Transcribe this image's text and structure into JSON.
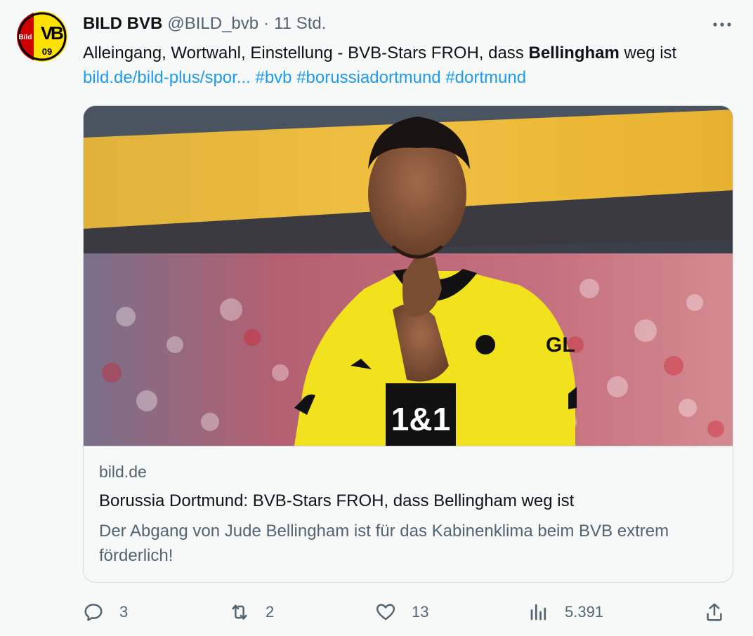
{
  "tweet": {
    "author_name": "BILD BVB",
    "handle": "@BILD_bvb",
    "separator": "·",
    "time": "11 Std.",
    "avatar_icon": "bild-bvb-logo",
    "more_icon": "more-icon",
    "text": {
      "part1": "Alleingang, Wortwahl, Einstellung - BVB-Stars FROH, dass ",
      "bold": "Bellingham",
      "part2": " weg ist ",
      "link": "bild.de/bild-plus/spor...",
      "hashtags": [
        "#bvb",
        "#borussiadortmund",
        "#dortmund"
      ]
    }
  },
  "avatar_logo": {
    "left_text": "Bild",
    "main_text": "B",
    "partial_text": "V",
    "year_text": "09",
    "colors": {
      "red": "#d00000",
      "yellow": "#fde100",
      "black": "#000000"
    }
  },
  "card": {
    "image_icon": "player-photo",
    "domain": "bild.de",
    "title": "Borussia Dortmund: BVB-Stars FROH, dass Bellingham weg ist",
    "description": "Der Abgang von Jude Bellingham ist für das Kabinenklima beim BVB extrem förderlich!",
    "shirt_sponsor": "1&1",
    "shirt_partial": "GL"
  },
  "actions": {
    "reply": {
      "icon": "reply-icon",
      "count": "3"
    },
    "retweet": {
      "icon": "retweet-icon",
      "count": "2"
    },
    "like": {
      "icon": "heart-icon",
      "count": "13"
    },
    "views": {
      "icon": "views-icon",
      "count": "5.391"
    },
    "share": {
      "icon": "share-icon"
    }
  },
  "colors": {
    "link": "#1d9bf0",
    "secondary_text": "#536471",
    "primary_text": "#0f1419",
    "border": "#cfd9de",
    "background": "#f7f9f9"
  }
}
